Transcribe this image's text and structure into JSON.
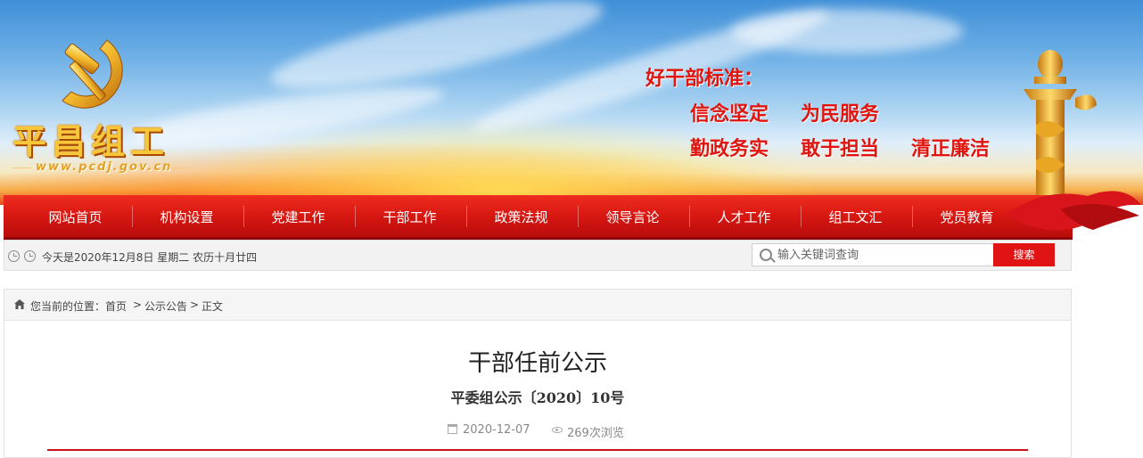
{
  "header": {
    "site_title": "平昌组工",
    "site_url": "www.pcdj.gov.cn",
    "slogan_heading": "好干部标准：",
    "slogan_line1": [
      "信念坚定",
      "为民服务"
    ],
    "slogan_line2": [
      "勤政务实",
      "敢于担当",
      "清正廉洁"
    ]
  },
  "nav": {
    "items": [
      {
        "label": "网站首页"
      },
      {
        "label": "机构设置"
      },
      {
        "label": "党建工作"
      },
      {
        "label": "干部工作"
      },
      {
        "label": "政策法规"
      },
      {
        "label": "领导言论"
      },
      {
        "label": "人才工作"
      },
      {
        "label": "组工文汇"
      },
      {
        "label": "党员教育"
      }
    ]
  },
  "infobar": {
    "date_text": "今天是2020年12月8日 星期二 农历十月廿四",
    "search_placeholder": "输入关键词查询",
    "search_button": "搜索"
  },
  "breadcrumb": {
    "prefix": "您当前的位置：",
    "home": "首页",
    "sep": ">",
    "section": "公示公告",
    "current": "正文"
  },
  "article": {
    "title": "干部任前公示",
    "doc_number": "平委组公示〔2020〕10号",
    "date": "2020-12-07",
    "views": "269次浏览"
  },
  "colors": {
    "nav_red": "#d41611",
    "slogan_red": "#e0150f",
    "title_gold": "#f7c63a",
    "search_button": "#e01414",
    "rule_red": "#c8141a"
  },
  "icons": [
    "party-emblem-icon",
    "clock-icon",
    "search-icon",
    "home-icon",
    "calendar-icon",
    "eye-icon",
    "pillar-icon"
  ]
}
